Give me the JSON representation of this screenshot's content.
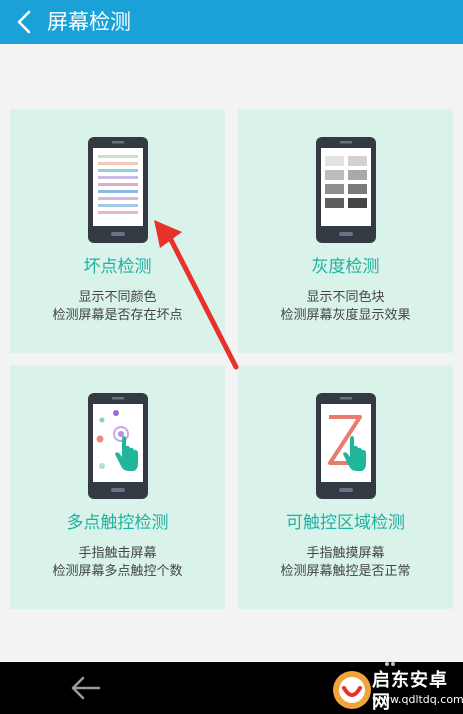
{
  "header": {
    "title": "屏幕检测",
    "background": "#1aa1d8"
  },
  "cards": [
    {
      "title": "坏点检测",
      "line1": "显示不同颜色",
      "line2": "检测屏幕是否存在坏点",
      "icon": "color-stripes-phone-icon"
    },
    {
      "title": "灰度检测",
      "line1": "显示不同色块",
      "line2": "检测屏幕灰度显示效果",
      "icon": "gray-blocks-phone-icon"
    },
    {
      "title": "多点触控检测",
      "line1": "手指触击屏幕",
      "line2": "检测屏幕多点触控个数",
      "icon": "multi-touch-phone-icon"
    },
    {
      "title": "可触控区域检测",
      "line1": "手指触摸屏幕",
      "line2": "检测屏幕触控是否正常",
      "icon": "touch-area-phone-icon"
    }
  ],
  "colors": {
    "card_bg": "#d9f3ea",
    "card_title": "#20b0a1",
    "annotation_arrow": "#e8312b"
  },
  "watermark": {
    "name": "启东安卓网",
    "url": "www.qdltdq.com"
  }
}
